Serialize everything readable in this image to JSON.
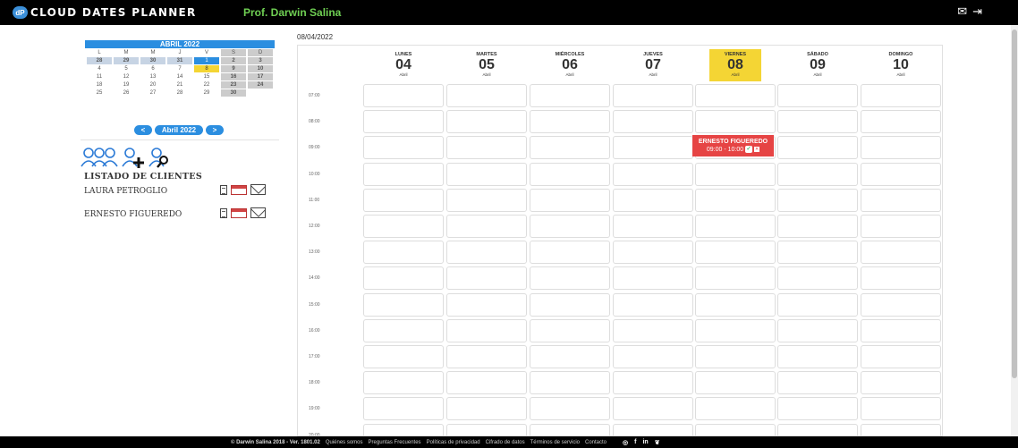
{
  "app": {
    "logo_text": "dP",
    "brand": "CLOUD DATES PLANNER",
    "professional": "Prof. Darwin Salina",
    "top_icons": [
      "mail-icon",
      "logout-icon"
    ]
  },
  "mini_calendar": {
    "title": "ABRIL 2022",
    "weekdays": [
      "L",
      "M",
      "M",
      "J",
      "V",
      "S",
      "D"
    ],
    "weeks": [
      [
        "28",
        "29",
        "30",
        "31",
        "1",
        "2",
        "3"
      ],
      [
        "4",
        "5",
        "6",
        "7",
        "8",
        "9",
        "10"
      ],
      [
        "11",
        "12",
        "13",
        "14",
        "15",
        "16",
        "17"
      ],
      [
        "18",
        "19",
        "20",
        "21",
        "22",
        "23",
        "24"
      ],
      [
        "25",
        "26",
        "27",
        "28",
        "29",
        "30",
        ""
      ]
    ],
    "prev_label": "<",
    "month_label": "Abril 2022",
    "next_label": ">"
  },
  "clients": {
    "title": "LISTADO DE CLIENTES",
    "items": [
      {
        "name": "LAURA PETROGLIO"
      },
      {
        "name": "ERNESTO FIGUEREDO"
      }
    ]
  },
  "calendar": {
    "current_date": "08/04/2022",
    "days": [
      {
        "name": "LUNES",
        "num": "04",
        "month": "Abril"
      },
      {
        "name": "MARTES",
        "num": "05",
        "month": "Abril"
      },
      {
        "name": "MIÉRCOLES",
        "num": "06",
        "month": "Abril"
      },
      {
        "name": "JUEVES",
        "num": "07",
        "month": "Abril"
      },
      {
        "name": "VIERNES",
        "num": "08",
        "month": "Abril"
      },
      {
        "name": "SÁBADO",
        "num": "09",
        "month": "Abril"
      },
      {
        "name": "DOMINGO",
        "num": "10",
        "month": "Abril"
      }
    ],
    "hours": [
      "07:00",
      "08:00",
      "09:00",
      "10:00",
      "11:00",
      "12:00",
      "13:00",
      "14:00",
      "15:00",
      "16:00",
      "17:00",
      "18:00",
      "19:00",
      "20:00"
    ],
    "event": {
      "title": "ERNESTO FIGUEREDO",
      "time": "09:00 - 10:00"
    }
  },
  "footer": {
    "copyright": "© Darwin Salina 2018 - Ver. 1801.02",
    "links": [
      "Quiénes somos",
      "Preguntas Frecuentes",
      "Políticas de privacidad",
      "Cifrado de datos",
      "Términos de servicio",
      "Contacto"
    ],
    "social": [
      "instagram-icon",
      "facebook-icon",
      "linkedin-icon",
      "twitter-icon"
    ]
  }
}
